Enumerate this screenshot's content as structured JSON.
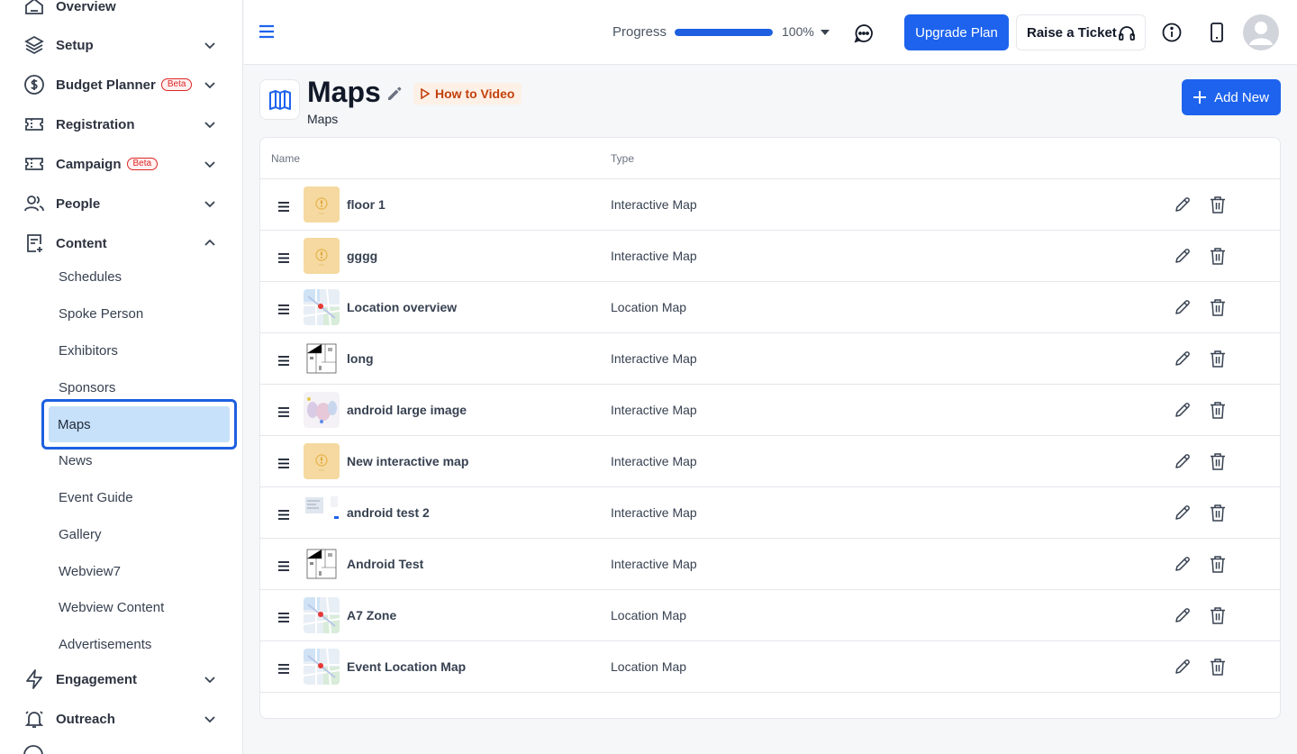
{
  "sidebar": {
    "items": [
      {
        "label": "Overview",
        "icon": "home-icon"
      },
      {
        "label": "Setup",
        "icon": "layers-icon"
      },
      {
        "label": "Budget Planner",
        "badge": "Beta",
        "icon": "dollar-circle-icon"
      },
      {
        "label": "Registration",
        "icon": "ticket-icon"
      },
      {
        "label": "Campaign",
        "badge": "Beta",
        "icon": "ticket-icon"
      },
      {
        "label": "People",
        "icon": "users-icon"
      },
      {
        "label": "Content",
        "icon": "document-plus-icon"
      },
      {
        "label": "Engagement",
        "icon": "bolt-icon"
      },
      {
        "label": "Outreach",
        "icon": "bell-icon"
      }
    ],
    "content_subitems": [
      "Schedules",
      "Spoke Person",
      "Exhibitors",
      "Sponsors",
      "Maps",
      "News",
      "Event Guide",
      "Gallery",
      "Webview7",
      "Webview Content",
      "Advertisements"
    ],
    "active_subitem": "Maps"
  },
  "topbar": {
    "progress_label": "Progress",
    "progress_value": "100%",
    "progress_fraction": 1.0,
    "upgrade_label": "Upgrade Plan",
    "ticket_label": "Raise a Ticket"
  },
  "page": {
    "title": "Maps",
    "subtitle": "Maps",
    "how_to_label": "How to Video",
    "add_new_label": "Add New"
  },
  "table": {
    "headers": [
      "Name",
      "Type"
    ],
    "rows": [
      {
        "name": "floor 1",
        "type": "Interactive Map",
        "thumb": "placeholder"
      },
      {
        "name": "gggg",
        "type": "Interactive Map",
        "thumb": "placeholder"
      },
      {
        "name": "Location overview",
        "type": "Location Map",
        "thumb": "street-map"
      },
      {
        "name": "long",
        "type": "Interactive Map",
        "thumb": "floor-plan"
      },
      {
        "name": "android large image",
        "type": "Interactive Map",
        "thumb": "blurry"
      },
      {
        "name": "New interactive map",
        "type": "Interactive Map",
        "thumb": "placeholder"
      },
      {
        "name": "android test 2",
        "type": "Interactive Map",
        "thumb": "screenshot"
      },
      {
        "name": "Android Test",
        "type": "Interactive Map",
        "thumb": "floor-plan"
      },
      {
        "name": "A7 Zone",
        "type": "Location Map",
        "thumb": "street-map"
      },
      {
        "name": "Event Location Map",
        "type": "Location Map",
        "thumb": "street-map"
      }
    ]
  },
  "colors": {
    "primary": "#1d63ed",
    "active_bg": "#c7e1fb",
    "beta": "#dc2626",
    "how_to_bg": "#fdf0e6"
  }
}
